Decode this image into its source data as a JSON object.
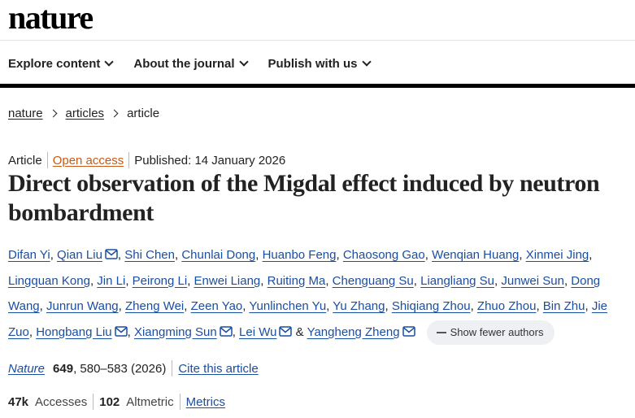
{
  "site": {
    "logo": "nature"
  },
  "nav": {
    "items": [
      {
        "label": "Explore content"
      },
      {
        "label": "About the journal"
      },
      {
        "label": "Publish with us"
      }
    ]
  },
  "breadcrumb": {
    "items": [
      "nature",
      "articles",
      "article"
    ]
  },
  "article_meta": {
    "type": "Article",
    "access": "Open access",
    "published": "Published: 14 January 2026"
  },
  "title": "Direct observation of the Migdal effect induced by neutron bombardment",
  "authors": [
    "Difan Yi",
    "Qian Liu",
    "Shi Chen",
    "Chunlai Dong",
    "Huanbo Feng",
    "Chaosong Gao",
    "Wenqian Huang",
    "Xinmei Jing",
    "Lingquan Kong",
    "Jin Li",
    "Peirong Li",
    "Enwei Liang",
    "Ruiting Ma",
    "Chenguang Su",
    "Liangliang Su",
    "Junwei Sun",
    "Dong Wang",
    "Junrun Wang",
    "Zheng Wei",
    "Zeen Yao",
    "Yunlinchen Yu",
    "Yu Zhang",
    "Shiqiang Zhou",
    "Zhuo Zhou",
    "Bin Zhu",
    "Jie Zuo",
    "Hongbang Liu",
    "Xiangming Sun",
    "Lei Wu",
    "Yangheng Zheng"
  ],
  "author_separator": ",",
  "author_last_separator": "&",
  "show_fewer_label": "Show fewer authors",
  "citation": {
    "journal": "Nature",
    "volume": "649",
    "pages": ", 580–583 (2026)",
    "cite_label": "Cite this article"
  },
  "metrics": {
    "accesses_value": "47k",
    "accesses_label": "Accesses",
    "altmetric_value": "102",
    "altmetric_label": "Altmetric",
    "metrics_link": "Metrics"
  },
  "colors": {
    "link": "#1a4ea1",
    "open_access": "#c85a12",
    "text": "#222222",
    "button_bg": "#eef0f3"
  },
  "icons": {
    "corresponding_author": "envelope-icon"
  }
}
